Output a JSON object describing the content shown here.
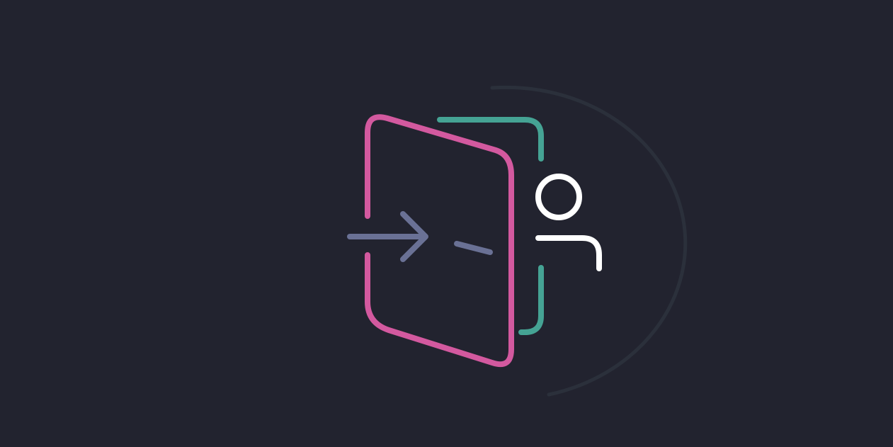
{
  "scene": {
    "subject": "login-door-illustration",
    "colors": {
      "background": "#22232f",
      "door_outline": "#d3599f",
      "door_frame": "#45a394",
      "arrow": "#6a7195",
      "person": "#ffffff",
      "arc": "#2b303b"
    },
    "icons": [
      "door-icon",
      "door-frame-icon",
      "arrow-right-icon",
      "user-icon",
      "arc-decoration"
    ]
  }
}
